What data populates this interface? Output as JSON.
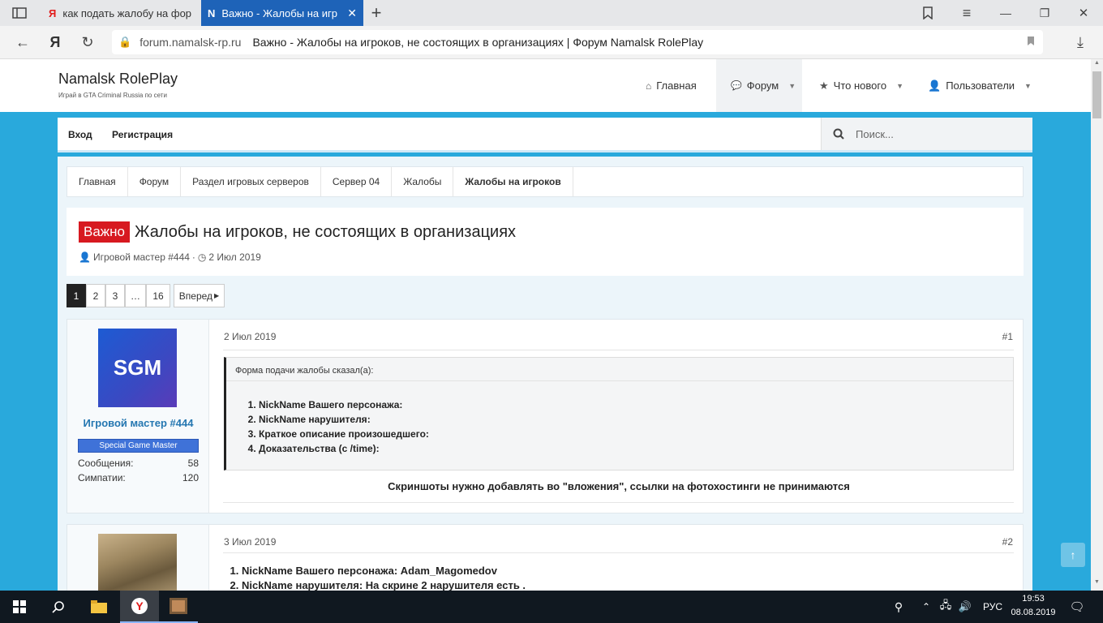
{
  "browser": {
    "tabs": [
      {
        "label": "как подать жалобу на фор"
      },
      {
        "label": "Важно - Жалобы на игр"
      }
    ],
    "url_domain": "forum.namalsk-rp.ru",
    "url_title": "Важно - Жалобы на игроков, не состоящих в организациях | Форум Namalsk RolePlay"
  },
  "site": {
    "logo_title": "Namalsk RolePlay",
    "logo_subtitle": "Играй в GTA Criminal Russia по сети",
    "nav": {
      "home": "Главная",
      "forum": "Форум",
      "whats_new": "Что нового",
      "users": "Пользователи"
    },
    "login": "Вход",
    "register": "Регистрация",
    "search_placeholder": "Поиск..."
  },
  "breadcrumb": [
    "Главная",
    "Форум",
    "Раздел игровых серверов",
    "Сервер 04",
    "Жалобы",
    "Жалобы на игроков"
  ],
  "thread": {
    "prefix": "Важно",
    "title": "Жалобы на игроков, не состоящих в организациях",
    "author": "Игровой мастер #444",
    "date": "2 Июл 2019",
    "sep": "·"
  },
  "pager": {
    "pages": [
      "1",
      "2",
      "3",
      "…",
      "16"
    ],
    "next": "Вперед"
  },
  "post1": {
    "avatar_text": "SGM",
    "username": "Игровой мастер #444",
    "user_title": "Special Game Master",
    "messages_label": "Сообщения:",
    "messages": "58",
    "likes_label": "Симпатии:",
    "likes": "120",
    "date": "2 Июл 2019",
    "num": "#1",
    "quote_header": "Форма подачи жалобы сказал(а):",
    "items": [
      "NickName Вашего персонажа:",
      "NickName нарушителя:",
      "Краткое описание произошедшего:",
      "Доказательства (с /time):"
    ],
    "note": "Скриншоты нужно добавлять во \"вложения\", ссылки на фотохостинги не принимаются"
  },
  "post2": {
    "date": "3 Июл 2019",
    "num": "#2",
    "items": [
      "NickName Вашего персонажа: Adam_Magomedov",
      "NickName нарушителя: На скрине 2 нарушителя есть ."
    ]
  },
  "taskbar": {
    "lang": "РУС",
    "time": "19:53",
    "date": "08.08.2019"
  },
  "colors": {
    "accent": "#29a9dc",
    "tab_active": "#1e63b8",
    "prefix_red": "#d71920",
    "link_blue": "#2577b1"
  }
}
